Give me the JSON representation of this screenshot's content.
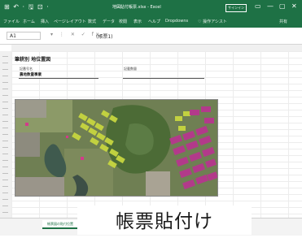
{
  "window": {
    "quick_access": "⊞ ↶ · 🖫 ⊡ ·",
    "title": "地図貼付帳票.xlsx - Excel",
    "signin": "サインイン",
    "controls": [
      "▭",
      "—",
      "▢",
      "✕"
    ]
  },
  "ribbon": {
    "tabs": [
      "ファイル",
      "ホーム",
      "挿入",
      "ページレイアウト",
      "数式",
      "データ",
      "校閲",
      "表示",
      "ヘルプ",
      "Dropdowns",
      "♡ 操作アシスト"
    ],
    "share": "共有"
  },
  "formula_bar": {
    "name_box": "A1",
    "icons": "▾ ⋮ ✕ ✓ fx",
    "value": "(帳票1)"
  },
  "document": {
    "title": "筆耕別 地位置図",
    "field1_label": "記番号名",
    "field1_value": "農地数量事業",
    "field2_label": "記載数量"
  },
  "sheet_tabs": [
    "帳票図の貼付位置"
  ],
  "caption": "帳票貼付け",
  "colors": {
    "excel_green": "#1e7145"
  }
}
